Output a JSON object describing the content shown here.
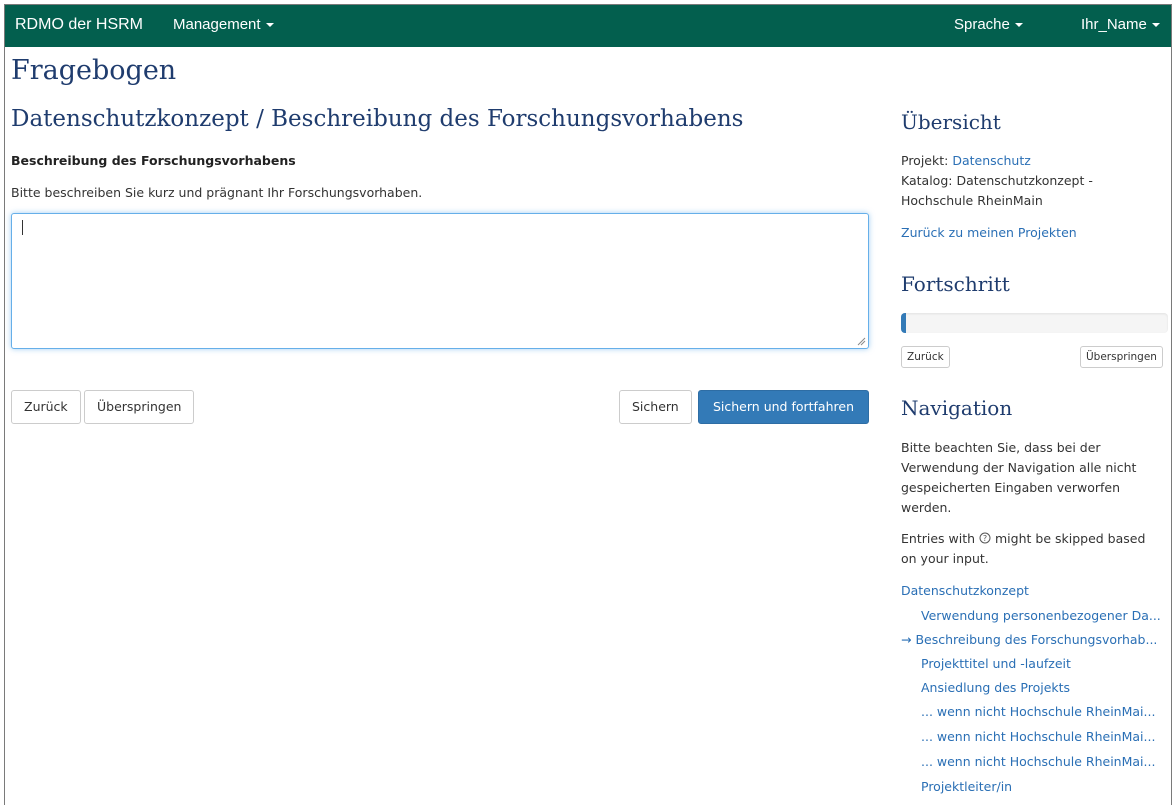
{
  "navbar": {
    "brand": "RDMO der HSRM",
    "management": "Management",
    "language": "Sprache",
    "user": "Ihr_Name"
  },
  "page": {
    "title": "Fragebogen",
    "section_title": "Datenschutzkonzept / Beschreibung des Forschungsvorhabens"
  },
  "question": {
    "label": "Beschreibung des Forschungsvorhabens",
    "help": "Bitte beschreiben Sie kurz und prägnant Ihr Forschungsvorhaben.",
    "value": ""
  },
  "buttons": {
    "back": "Zurück",
    "skip": "Überspringen",
    "save": "Sichern",
    "save_continue": "Sichern und fortfahren"
  },
  "sidebar": {
    "overview_title": "Übersicht",
    "project_prefix": "Projekt: ",
    "project_name": "Datenschutz",
    "catalog_line1": "Katalog: Datenschutzkonzept -",
    "catalog_line2": "Hochschule RheinMain",
    "back_to_projects": "Zurück zu meinen Projekten",
    "progress_title": "Fortschritt",
    "progress_value": 0.01,
    "progress_back": "Zurück",
    "progress_skip": "Überspringen",
    "navigation_title": "Navigation",
    "nav_warning_1": "Bitte beachten Sie, dass bei der",
    "nav_warning_2": "Verwendung der Navigation alle nicht",
    "nav_warning_3": "gespeicherten Eingaben verworfen",
    "nav_warning_4": "werden.",
    "skip_note_1": "Entries with",
    "skip_note_icon": "question-circle-icon",
    "skip_note_2": "might be skipped based",
    "skip_note_3": "on your input.",
    "nav_section": "Datenschutzkonzept",
    "nav_items": [
      "Verwendung personenbezogener Da...",
      "Beschreibung des Forschungsvorhab...",
      "Projekttitel und -laufzeit",
      "Ansiedlung des Projekts",
      "... wenn nicht Hochschule RheinMai...",
      "... wenn nicht Hochschule RheinMai...",
      "... wenn nicht Hochschule RheinMai...",
      "Projektleiter/in"
    ],
    "current_marker": "→"
  },
  "colors": {
    "navbar": "#035f4e",
    "primary": "#337ab7",
    "link": "#2a6fb5",
    "heading": "#1f3c6e"
  }
}
